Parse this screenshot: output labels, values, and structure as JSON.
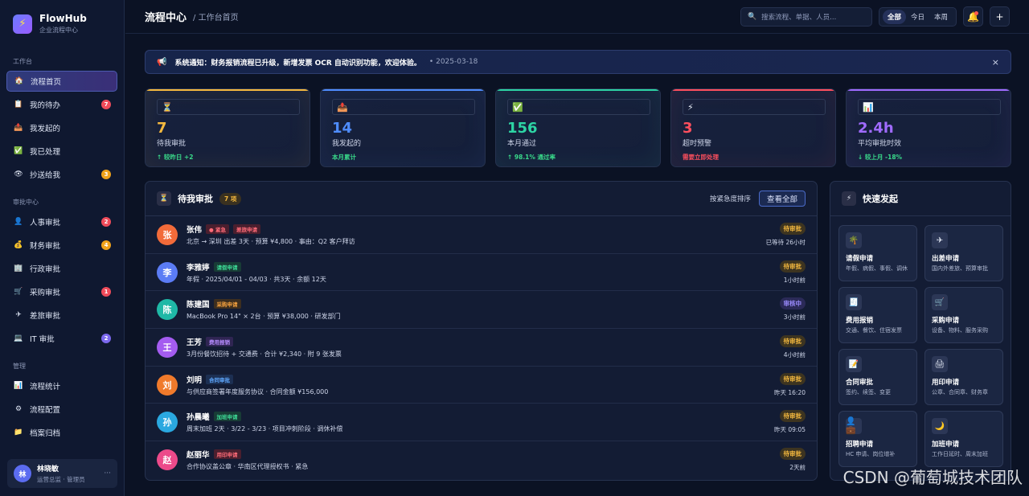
{
  "brand": {
    "name": "FlowHub",
    "subtitle": "企业流程中心",
    "logo_icon": "⚡"
  },
  "sidebar": {
    "sections": [
      {
        "title": "工作台",
        "items": [
          {
            "icon": "🏠",
            "label": "流程首页",
            "active": true,
            "badge": ""
          },
          {
            "icon": "📋",
            "label": "我的待办",
            "badge": "7",
            "badge_color": "#ef4b5a"
          },
          {
            "icon": "📤",
            "label": "我发起的",
            "badge": ""
          },
          {
            "icon": "✅",
            "label": "我已处理",
            "badge": ""
          },
          {
            "icon": "👁",
            "label": "抄送给我",
            "badge": "3",
            "badge_color": "#f0a21a"
          }
        ]
      },
      {
        "title": "审批中心",
        "items": [
          {
            "icon": "👤",
            "label": "人事审批",
            "badge": "2",
            "badge_color": "#ef4b5a"
          },
          {
            "icon": "💰",
            "label": "财务审批",
            "badge": "4",
            "badge_color": "#f0a21a"
          },
          {
            "icon": "🏢",
            "label": "行政审批",
            "badge": ""
          },
          {
            "icon": "🛒",
            "label": "采购审批",
            "badge": "1",
            "badge_color": "#ef4b5a"
          },
          {
            "icon": "✈",
            "label": "差旅审批",
            "badge": ""
          },
          {
            "icon": "💻",
            "label": "IT 审批",
            "badge": "2",
            "badge_color": "#7b68ee"
          }
        ]
      },
      {
        "title": "管理",
        "items": [
          {
            "icon": "📊",
            "label": "流程统计",
            "badge": ""
          },
          {
            "icon": "⚙",
            "label": "流程配置",
            "badge": ""
          },
          {
            "icon": "📁",
            "label": "档案归档",
            "badge": ""
          }
        ]
      }
    ],
    "user": {
      "avatar": "林",
      "name": "林晓敏",
      "role": "运营总监 · 管理员",
      "more": "···"
    }
  },
  "header": {
    "title": "流程中心",
    "breadcrumb": "/ 工作台首页",
    "search_placeholder": "搜索流程、单据、人员...",
    "segments": [
      "全部",
      "今日",
      "本周"
    ],
    "bell_icon": "🔔",
    "add_icon": "+"
  },
  "notice": {
    "icon": "📢",
    "text": "系统通知：财务报销流程已升级，新增发票 OCR 自动识别功能，欢迎体验。",
    "date": "•  2025-03-18",
    "close": "×"
  },
  "stats": [
    {
      "icon": "⏳",
      "value": "7",
      "label": "待我审批",
      "sub": "↑ 较昨日 +2",
      "color": "#f5b93f",
      "sub_color": "#39d98a"
    },
    {
      "icon": "📤",
      "value": "14",
      "label": "我发起的",
      "sub": "本月累计",
      "color": "#4f8dff",
      "sub_color": "#39d98a"
    },
    {
      "icon": "✅",
      "value": "156",
      "label": "本月通过",
      "sub": "↑ 98.1% 通过率",
      "color": "#2dd4a4",
      "sub_color": "#39d98a"
    },
    {
      "icon": "⚡",
      "value": "3",
      "label": "超时预警",
      "sub": "需要立即处理",
      "color": "#ff4f5e",
      "sub_color": "#ff4f5e"
    },
    {
      "icon": "📊",
      "value": "2.4h",
      "label": "平均审批时效",
      "sub": "↓ 较上月 -18%",
      "color": "#a06bff",
      "sub_color": "#39d98a"
    }
  ],
  "pending": {
    "icon": "⏳",
    "title": "待我审批",
    "count": "7 项",
    "sort_label": "按紧急度排序",
    "view_all": "查看全部",
    "rows": [
      {
        "avatar": "张",
        "avatar_color": "#f26b3a",
        "name": "张伟",
        "tags": [
          {
            "text": "● 紧急",
            "fg": "#ff6b78",
            "bg": "#4a1f2e"
          },
          {
            "text": "差旅申请",
            "fg": "#ff6b78",
            "bg": "#4a1f2e"
          }
        ],
        "detail": "北京 → 深圳 出差 3天 · 预算 ¥4,800 · 事由：Q2 客户拜访",
        "status": "待审批",
        "status_fg": "#f5b93f",
        "status_bg": "#3d3420",
        "time": "已等待 26小时"
      },
      {
        "avatar": "李",
        "avatar_color": "#5b7cf5",
        "name": "李雅婷",
        "tags": [
          {
            "text": "请假申请",
            "fg": "#3ddc97",
            "bg": "#183c36"
          }
        ],
        "detail": "年假 · 2025/04/01 - 04/03 · 共3天 · 余额 12天",
        "status": "待审批",
        "status_fg": "#f5b93f",
        "status_bg": "#3d3420",
        "time": "1小时前"
      },
      {
        "avatar": "陈",
        "avatar_color": "#1fb8a6",
        "name": "陈建国",
        "tags": [
          {
            "text": "采购申请",
            "fg": "#f5a13f",
            "bg": "#3d2e1f"
          }
        ],
        "detail": "MacBook Pro 14\" × 2台 · 预算 ¥38,000 · 研发部门",
        "status": "审核中",
        "status_fg": "#9b8cff",
        "status_bg": "#2b2a58",
        "time": "3小时前"
      },
      {
        "avatar": "王",
        "avatar_color": "#a45cf0",
        "name": "王芳",
        "tags": [
          {
            "text": "费用报销",
            "fg": "#b58cff",
            "bg": "#2f2552"
          }
        ],
        "detail": "3月份餐饮招待 + 交通费 · 合计 ¥2,340 · 附 9 张发票",
        "status": "待审批",
        "status_fg": "#f5b93f",
        "status_bg": "#3d3420",
        "time": "4小时前"
      },
      {
        "avatar": "刘",
        "avatar_color": "#f07a2b",
        "name": "刘明",
        "tags": [
          {
            "text": "合同审批",
            "fg": "#5fa8ff",
            "bg": "#1c2f52"
          }
        ],
        "detail": "与供应商签署年度服务协议 · 合同金额 ¥156,000",
        "status": "待审批",
        "status_fg": "#f5b93f",
        "status_bg": "#3d3420",
        "time": "昨天 16:20"
      },
      {
        "avatar": "孙",
        "avatar_color": "#2aa8e0",
        "name": "孙晨曦",
        "tags": [
          {
            "text": "加班申请",
            "fg": "#3ddc97",
            "bg": "#183c36"
          }
        ],
        "detail": "周末加班 2天 · 3/22 - 3/23 · 项目冲刺阶段 · 调休补偿",
        "status": "待审批",
        "status_fg": "#f5b93f",
        "status_bg": "#3d3420",
        "time": "昨天 09:05"
      },
      {
        "avatar": "赵",
        "avatar_color": "#ec4a8a",
        "name": "赵丽华",
        "tags": [
          {
            "text": "用印申请",
            "fg": "#ff6b78",
            "bg": "#4a1f2e"
          }
        ],
        "detail": "合作协议盖公章 · 华南区代理授权书 · 紧急",
        "status": "待审批",
        "status_fg": "#f5b93f",
        "status_bg": "#3d3420",
        "time": "2天前"
      }
    ]
  },
  "quick": {
    "icon": "⚡",
    "title": "快速发起",
    "items": [
      {
        "icon": "🌴",
        "title": "请假申请",
        "desc": "年假、病假、事假、调休"
      },
      {
        "icon": "✈",
        "title": "出差申请",
        "desc": "国内外差旅、预算审批"
      },
      {
        "icon": "🧾",
        "title": "费用报销",
        "desc": "交通、餐饮、住宿发票"
      },
      {
        "icon": "🛒",
        "title": "采购申请",
        "desc": "设备、物料、服务采购"
      },
      {
        "icon": "📝",
        "title": "合同审批",
        "desc": "签约、续签、变更"
      },
      {
        "icon": "🖨",
        "title": "用印申请",
        "desc": "公章、合同章、财务章"
      },
      {
        "icon": "👤💼",
        "title": "招聘申请",
        "desc": "HC 申请、岗位增补"
      },
      {
        "icon": "🌙",
        "title": "加班申请",
        "desc": "工作日延时、周末加班"
      }
    ]
  },
  "watermark": "CSDN @葡萄城技术团队"
}
